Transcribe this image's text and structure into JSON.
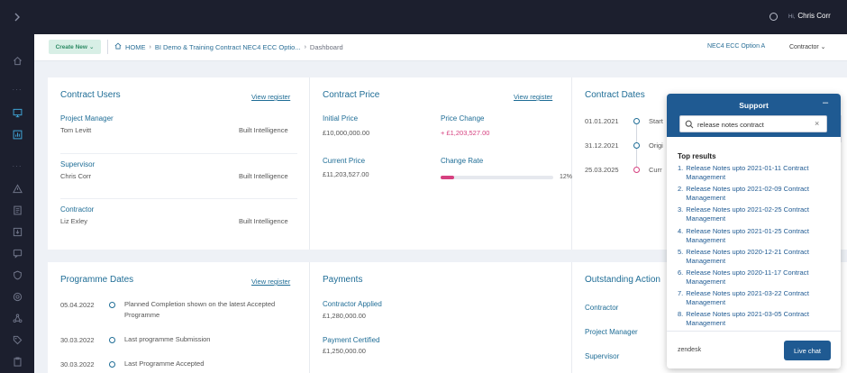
{
  "topbar": {
    "greeting": "Hi,",
    "user_name": "Chris Corr"
  },
  "header": {
    "create_label": "Create New",
    "breadcrumb": {
      "home": "HOME",
      "contract": "BI Demo & Training Contract NEC4 ECC Optio...",
      "current": "Dashboard"
    },
    "option_label": "NEC4 ECC Option A",
    "role_label": "Contractor"
  },
  "contract_users": {
    "title": "Contract Users",
    "view_label": "View register",
    "items": [
      {
        "role": "Project Manager",
        "name": "Tom Levitt",
        "org": "Built Intelligence"
      },
      {
        "role": "Supervisor",
        "name": "Chris Corr",
        "org": "Built Intelligence"
      },
      {
        "role": "Contractor",
        "name": "Liz Exley",
        "org": "Built Intelligence"
      }
    ]
  },
  "contract_price": {
    "title": "Contract Price",
    "view_label": "View register",
    "initial_label": "Initial Price",
    "initial_value": "£10,000,000.00",
    "change_label": "Price Change",
    "change_value": "+ £1,203,527.00",
    "current_label": "Current Price",
    "current_value": "£11,203,527.00",
    "rate_label": "Change Rate",
    "rate_text": "12%",
    "rate_fraction": 0.12
  },
  "contract_dates": {
    "title": "Contract Dates",
    "items": [
      {
        "date": "01.01.2021",
        "text": "Start"
      },
      {
        "date": "31.12.2021",
        "text": "Origi"
      },
      {
        "date": "25.03.2025",
        "text": "Curr"
      }
    ]
  },
  "programme_dates": {
    "title": "Programme Dates",
    "view_label": "View register",
    "items": [
      {
        "date": "05.04.2022",
        "text": "Planned Completion shown on the latest Accepted Programme"
      },
      {
        "date": "30.03.2022",
        "text": "Last programme Submission"
      },
      {
        "date": "30.03.2022",
        "text": "Last Programme Accepted"
      }
    ]
  },
  "payments": {
    "title": "Payments",
    "applied_label": "Contractor Applied",
    "applied_value": "£1,280,000.00",
    "certified_label": "Payment Certified",
    "certified_value": "£1,250,000.00"
  },
  "outstanding": {
    "title": "Outstanding Action",
    "items": [
      "Contractor",
      "Project Manager",
      "Supervisor"
    ]
  },
  "support": {
    "title": "Support",
    "minimize": "–",
    "search_value": "release notes contract",
    "results_title": "Top results",
    "results": [
      {
        "num": "1.",
        "text": "Release Notes upto 2021-01-11 Contract Management"
      },
      {
        "num": "2.",
        "text": "Release Notes upto 2021-02-09 Contract Management"
      },
      {
        "num": "3.",
        "text": "Release Notes upto 2021-02-25 Contract Management"
      },
      {
        "num": "4.",
        "text": "Release Notes upto 2021-01-25 Contract Management"
      },
      {
        "num": "5.",
        "text": "Release Notes upto 2020-12-21 Contract Management"
      },
      {
        "num": "6.",
        "text": "Release Notes upto 2020-11-17 Contract Management"
      },
      {
        "num": "7.",
        "text": "Release Notes upto 2021-03-22 Contract Management"
      },
      {
        "num": "8.",
        "text": "Release Notes upto 2021-03-05 Contract Management"
      }
    ],
    "brand": "zendesk",
    "chat_label": "Live chat"
  },
  "colors": {
    "accent": "#1f6d96",
    "danger": "#d6407f",
    "sidebar": "#1c1f2e",
    "support": "#1f5a92"
  }
}
